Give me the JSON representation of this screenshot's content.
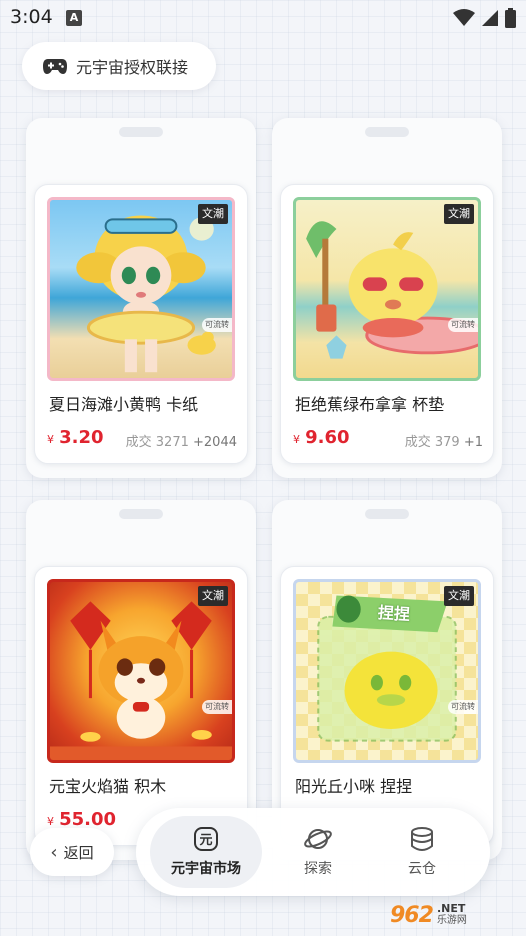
{
  "status_bar": {
    "time": "3:04",
    "notification_letter": "A",
    "icons": [
      "wifi-icon",
      "signal-icon",
      "battery-icon"
    ]
  },
  "auth": {
    "label": "元宇宙授权联接",
    "icon": "gamepad-icon"
  },
  "products": [
    {
      "title": "夏日海滩小黄鸭 卡纸",
      "currency": "¥",
      "price": "3.20",
      "sales_label": "成交 3271",
      "sales_delta": "+2044",
      "tag": "文潮",
      "transfer_tag": "可流转",
      "art": "beach-duck-girl"
    },
    {
      "title": "拒绝蕉绿布拿拿 杯垫",
      "currency": "¥",
      "price": "9.60",
      "sales_label": "成交 379",
      "sales_delta": "+1",
      "tag": "文潮",
      "transfer_tag": "可流转",
      "art": "banana-character"
    },
    {
      "title": "元宝火焰猫 积木",
      "currency": "¥",
      "price": "55.00",
      "sales_label": "",
      "sales_delta": "",
      "tag": "文潮",
      "transfer_tag": "可流转",
      "art": "fire-cat"
    },
    {
      "title": "阳光丘小咪 捏捏",
      "currency": "",
      "price": "",
      "sales_label": "",
      "sales_delta": "",
      "tag": "文潮",
      "transfer_tag": "可流转",
      "badge_text": "捏捏",
      "art": "yellow-chick"
    }
  ],
  "back_button": {
    "label": "返回"
  },
  "bottom_nav": {
    "items": [
      {
        "label": "元宇宙市场",
        "icon": "yuan-icon",
        "active": true
      },
      {
        "label": "探索",
        "icon": "planet-icon",
        "active": false
      },
      {
        "label": "云仓",
        "icon": "storage-icon",
        "active": false
      }
    ]
  },
  "watermark": {
    "number": "962",
    "suffix": ".NET",
    "cn": "乐游网"
  },
  "colors": {
    "price_red": "#e0242f",
    "background": "#f3f5f9",
    "watermark_orange": "#f08a24"
  }
}
